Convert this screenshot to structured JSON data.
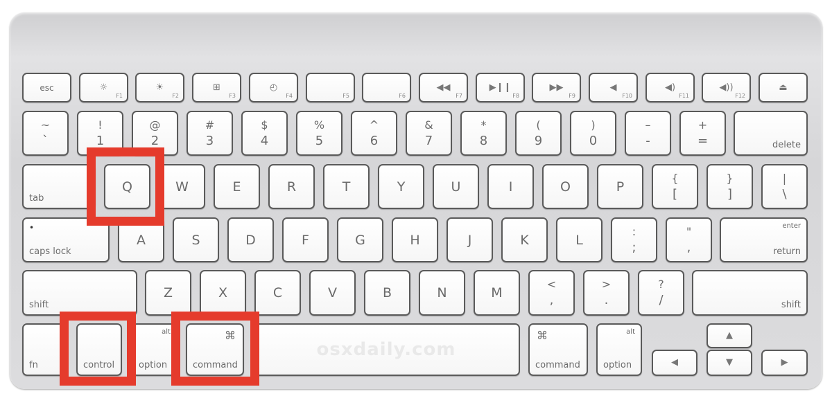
{
  "watermark": "osxdaily.com",
  "highlight_color": "#e53b2c",
  "highlighted_keys": [
    "Q",
    "control",
    "command"
  ],
  "rows": [
    [
      {
        "label": "esc"
      },
      {
        "glyph": "☼",
        "icon": "brightness-down-icon",
        "sub": "F1"
      },
      {
        "glyph": "☀",
        "icon": "brightness-up-icon",
        "sub": "F2"
      },
      {
        "glyph": "⊞",
        "icon": "expose-icon",
        "sub": "F3"
      },
      {
        "glyph": "◴",
        "icon": "dashboard-icon",
        "sub": "F4"
      },
      {
        "sub": "F5"
      },
      {
        "sub": "F6"
      },
      {
        "glyph": "◀◀",
        "icon": "rewind-icon",
        "sub": "F7"
      },
      {
        "glyph": "▶❙❙",
        "icon": "play-pause-icon",
        "sub": "F8"
      },
      {
        "glyph": "▶▶",
        "icon": "fast-forward-icon",
        "sub": "F9"
      },
      {
        "glyph": "◀",
        "icon": "mute-icon",
        "sub": "F10"
      },
      {
        "glyph": "◀)",
        "icon": "volume-down-icon",
        "sub": "F11"
      },
      {
        "glyph": "◀))",
        "icon": "volume-up-icon",
        "sub": "F12"
      },
      {
        "glyph": "⏏",
        "icon": "eject-icon"
      }
    ],
    [
      {
        "upper": "~",
        "lower": "`"
      },
      {
        "upper": "!",
        "lower": "1"
      },
      {
        "upper": "@",
        "lower": "2"
      },
      {
        "upper": "#",
        "lower": "3"
      },
      {
        "upper": "$",
        "lower": "4"
      },
      {
        "upper": "%",
        "lower": "5"
      },
      {
        "upper": "^",
        "lower": "6"
      },
      {
        "upper": "&",
        "lower": "7"
      },
      {
        "upper": "*",
        "lower": "8"
      },
      {
        "upper": "(",
        "lower": "9"
      },
      {
        "upper": ")",
        "lower": "0"
      },
      {
        "upper": "–",
        "lower": "-"
      },
      {
        "upper": "+",
        "lower": "="
      },
      {
        "br": "delete"
      }
    ],
    [
      {
        "bl": "tab"
      },
      {
        "label": "Q"
      },
      {
        "label": "W"
      },
      {
        "label": "E"
      },
      {
        "label": "R"
      },
      {
        "label": "T"
      },
      {
        "label": "Y"
      },
      {
        "label": "U"
      },
      {
        "label": "I"
      },
      {
        "label": "O"
      },
      {
        "label": "P"
      },
      {
        "upper": "{",
        "lower": "["
      },
      {
        "upper": "}",
        "lower": "]"
      },
      {
        "upper": "|",
        "lower": "\\"
      }
    ],
    [
      {
        "bl": "caps lock",
        "dot": "•"
      },
      {
        "label": "A"
      },
      {
        "label": "S"
      },
      {
        "label": "D"
      },
      {
        "label": "F"
      },
      {
        "label": "G"
      },
      {
        "label": "H"
      },
      {
        "label": "J"
      },
      {
        "label": "K"
      },
      {
        "label": "L"
      },
      {
        "upper": ":",
        "lower": ";"
      },
      {
        "upper": "\"",
        "lower": ","
      },
      {
        "br": "return",
        "tr": "enter"
      }
    ],
    [
      {
        "bl": "shift"
      },
      {
        "label": "Z"
      },
      {
        "label": "X"
      },
      {
        "label": "C"
      },
      {
        "label": "V"
      },
      {
        "label": "B"
      },
      {
        "label": "N"
      },
      {
        "label": "M"
      },
      {
        "upper": "<",
        "lower": ","
      },
      {
        "upper": ">",
        "lower": "."
      },
      {
        "upper": "?",
        "lower": "/"
      },
      {
        "br": "shift"
      }
    ],
    [
      {
        "bl": "fn"
      },
      {
        "bl": "control"
      },
      {
        "bl": "option",
        "tr": "alt"
      },
      {
        "bl": "command",
        "trg": "⌘"
      },
      {
        "space": true
      },
      {
        "bl": "command",
        "tlg": "⌘"
      },
      {
        "bl": "option",
        "tr": "alt"
      },
      {
        "glyph": "◀",
        "icon": "arrow-left-icon"
      },
      {
        "glyph": "▲",
        "icon": "arrow-up-icon"
      },
      {
        "glyph": "▼",
        "icon": "arrow-down-icon"
      },
      {
        "glyph": "▶",
        "icon": "arrow-right-icon"
      }
    ]
  ]
}
